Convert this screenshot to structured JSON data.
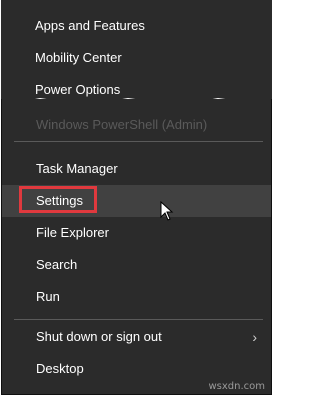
{
  "menu_top": {
    "items": [
      {
        "label": "Apps and Features"
      },
      {
        "label": "Mobility Center"
      },
      {
        "label": "Power Options"
      }
    ]
  },
  "menu_bottom": {
    "ghost_item": "Windows PowerShell (Admin)",
    "items": [
      {
        "label": "Task Manager"
      },
      {
        "label": "Settings"
      },
      {
        "label": "File Explorer"
      },
      {
        "label": "Search"
      },
      {
        "label": "Run"
      },
      {
        "label": "Shut down or sign out",
        "chevron": "›"
      },
      {
        "label": "Desktop"
      }
    ]
  },
  "watermark": "wsxdn.com",
  "icons": {
    "cursor": "mouse-pointer-icon",
    "submenu": "chevron-right-icon"
  },
  "colors": {
    "menu_bg": "#2b2b2b",
    "hover_bg": "#414141",
    "highlight": "#e0393e",
    "text": "#ffffff"
  }
}
